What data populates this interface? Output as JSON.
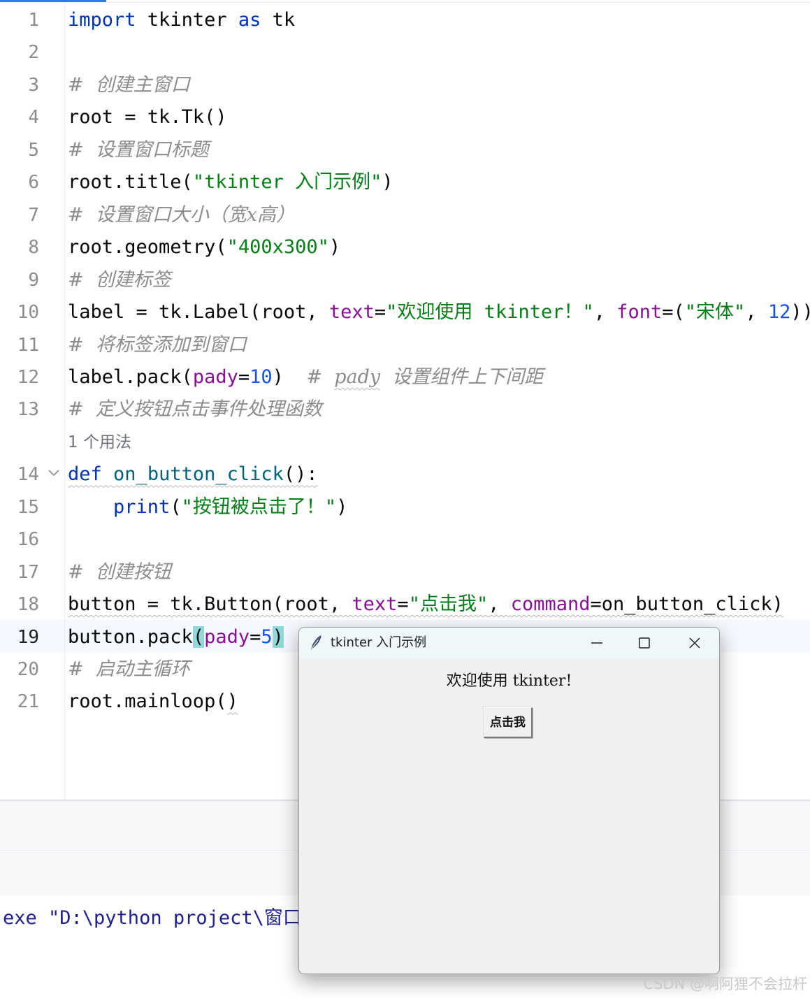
{
  "editor": {
    "lines": [
      {
        "number": "1",
        "parts": [
          {
            "t": "import",
            "c": "kw"
          },
          {
            "t": " tkinter "
          },
          {
            "t": "as",
            "c": "kw"
          },
          {
            "t": " tk"
          }
        ]
      },
      {
        "number": "2",
        "parts": []
      },
      {
        "number": "3",
        "parts": [
          {
            "t": "#  创建主窗口",
            "c": "cmt"
          }
        ]
      },
      {
        "number": "4",
        "parts": [
          {
            "t": "root = tk.Tk()"
          }
        ]
      },
      {
        "number": "5",
        "parts": [
          {
            "t": "#  设置窗口标题",
            "c": "cmt"
          }
        ]
      },
      {
        "number": "6",
        "parts": [
          {
            "t": "root.title("
          },
          {
            "t": "\"tkinter 入门示例\"",
            "c": "str"
          },
          {
            "t": ")"
          }
        ]
      },
      {
        "number": "7",
        "parts": [
          {
            "t": "#  设置窗口大小（宽x高）",
            "c": "cmt"
          }
        ]
      },
      {
        "number": "8",
        "parts": [
          {
            "t": "root.geometry("
          },
          {
            "t": "\"400x300\"",
            "c": "str"
          },
          {
            "t": ")"
          }
        ]
      },
      {
        "number": "9",
        "parts": [
          {
            "t": "#  创建标签",
            "c": "cmt"
          }
        ]
      },
      {
        "number": "10",
        "parts": [
          {
            "t": "label = tk.Label(root, "
          },
          {
            "t": "text",
            "c": "param"
          },
          {
            "t": "="
          },
          {
            "t": "\"欢迎使用 tkinter！\"",
            "c": "str"
          },
          {
            "t": ", "
          },
          {
            "t": "font",
            "c": "param"
          },
          {
            "t": "=("
          },
          {
            "t": "\"宋体\"",
            "c": "str"
          },
          {
            "t": ", "
          },
          {
            "t": "12",
            "c": "num"
          },
          {
            "t": "))"
          }
        ]
      },
      {
        "number": "11",
        "parts": [
          {
            "t": "#  将标签添加到窗口",
            "c": "cmt"
          }
        ]
      },
      {
        "number": "12",
        "parts": [
          {
            "t": "label.pack("
          },
          {
            "t": "pady",
            "c": "param"
          },
          {
            "t": "="
          },
          {
            "t": "10",
            "c": "num"
          },
          {
            "t": ")  "
          },
          {
            "t": "#  ",
            "c": "cmt"
          },
          {
            "t": "pady",
            "c": "cmt squiggle"
          },
          {
            "t": "  设置组件上下间距",
            "c": "cmt"
          }
        ]
      },
      {
        "number": "13",
        "parts": [
          {
            "t": "#  定义按钮点击事件处理函数",
            "c": "cmt"
          }
        ]
      },
      {
        "number": "",
        "usages": "1 个用法"
      },
      {
        "number": "14",
        "fold": true,
        "parts": [
          {
            "t": "def",
            "c": "kw squiggle"
          },
          {
            "t": " ",
            "c": "squiggle"
          },
          {
            "t": "on_button_click",
            "c": "fn squiggle"
          },
          {
            "t": "():",
            "c": "squiggle"
          }
        ]
      },
      {
        "number": "15",
        "parts": [
          {
            "t": "    "
          },
          {
            "t": "print",
            "c": "kw"
          },
          {
            "t": "("
          },
          {
            "t": "\"按钮被点击了！\"",
            "c": "str"
          },
          {
            "t": ")"
          }
        ]
      },
      {
        "number": "16",
        "parts": []
      },
      {
        "number": "17",
        "parts": [
          {
            "t": "#  创建按钮",
            "c": "cmt"
          }
        ]
      },
      {
        "number": "18",
        "parts": [
          {
            "t": "button = tk.Button(root, ",
            "c": "squiggle"
          },
          {
            "t": "text",
            "c": "param squiggle"
          },
          {
            "t": "=",
            "c": "squiggle"
          },
          {
            "t": "\"点击我\"",
            "c": "str squiggle"
          },
          {
            "t": ", ",
            "c": "squiggle"
          },
          {
            "t": "command",
            "c": "param squiggle"
          },
          {
            "t": "=on_button_click)",
            "c": "squiggle"
          }
        ]
      },
      {
        "number": "19",
        "active": true,
        "parts": [
          {
            "t": "button.pack"
          },
          {
            "t": "(",
            "c": "match"
          },
          {
            "t": "pady",
            "c": "param"
          },
          {
            "t": "="
          },
          {
            "t": "5",
            "c": "num"
          },
          {
            "t": ")",
            "c": "match"
          }
        ]
      },
      {
        "number": "20",
        "parts": [
          {
            "t": "#  启动主循环",
            "c": "cmt"
          }
        ]
      },
      {
        "number": "21",
        "parts": [
          {
            "t": "root.mainloop("
          },
          {
            "t": ")",
            "c": "squiggle"
          }
        ]
      }
    ]
  },
  "console": {
    "line": "exe \"D:\\python project\\窗口"
  },
  "tk_window": {
    "title": "tkinter 入门示例",
    "label_text": "欢迎使用 tkinter!",
    "button_text": "点击我"
  },
  "watermark": "CSDN @啊阿狸不会拉杆"
}
